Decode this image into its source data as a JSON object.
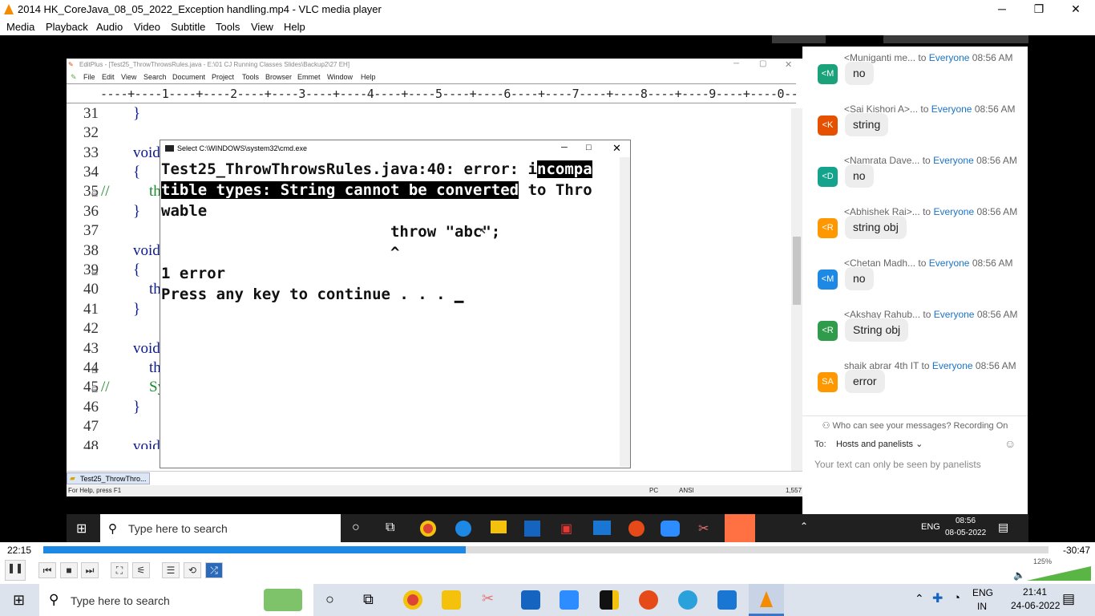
{
  "window": {
    "title": "2014 HK_CoreJava_08_05_2022_Exception handling.mp4 - VLC media player",
    "minimize": "─",
    "maximize": "❐",
    "close": "✕"
  },
  "menu": [
    "Media",
    "Playback",
    "Audio",
    "Video",
    "Subtitle",
    "Tools",
    "View",
    "Help"
  ],
  "editor": {
    "title": "EditPlus - [Test25_ThrowThrowsRules.java - E:\\01 CJ Running Classes Slides\\Backup2\\27 EH]",
    "menu": [
      "File",
      "Edit",
      "View",
      "Search",
      "Document",
      "Project",
      "Tools",
      "Browser",
      "Emmet",
      "Window",
      "Help"
    ],
    "ruler": "----+----1----+----2----+----3----+----4----+----5----+----6----+----7----+----8----+----9----+----0----+---",
    "lines": [
      {
        "num": "31",
        "code": "}"
      },
      {
        "num": "32",
        "code": ""
      },
      {
        "num": "33",
        "code": "void"
      },
      {
        "num": "34",
        "code": "{"
      },
      {
        "num": "35",
        "code": "th"
      },
      {
        "num": "36",
        "code": "}"
      },
      {
        "num": "37",
        "code": ""
      },
      {
        "num": "38",
        "code": "void"
      },
      {
        "num": "39",
        "code": "{"
      },
      {
        "num": "40",
        "code": "th"
      },
      {
        "num": "41",
        "code": "}"
      },
      {
        "num": "42",
        "code": ""
      },
      {
        "num": "43",
        "code": "void"
      },
      {
        "num": "44",
        "code": "th"
      },
      {
        "num": "45",
        "code": "Sy"
      },
      {
        "num": "46",
        "code": "}"
      },
      {
        "num": "47",
        "code": ""
      },
      {
        "num": "48",
        "code": "void"
      }
    ],
    "comment_marker": "//",
    "tab": "Test25_ThrowThro...",
    "status_left": "For Help, press F1",
    "status_pc": "PC",
    "status_ansi": "ANSI",
    "status_size": "1,557"
  },
  "cmd": {
    "title": "Select C:\\WINDOWS\\system32\\cmd.exe",
    "l1a": "Test25_ThrowThrowsRules.java:40: error: i",
    "l1b": "ncompa",
    "l2a": "tible types: String cannot be converted",
    "l2b": " to Thro",
    "l3": "wable",
    "l4": "                         throw \"abc\";",
    "l5": "                         ^",
    "l6": "1 error",
    "l7": "Press any key to continue . . . ",
    "cursor": "▁"
  },
  "chat": {
    "to": "to",
    "everyone": "Everyone",
    "messages": [
      {
        "sender": "<Muniganti me...",
        "time": "08:56 AM",
        "initials": "<M",
        "text": "no",
        "color": "#1aa37a"
      },
      {
        "sender": "<Sai Kishori A>...",
        "time": "08:56 AM",
        "initials": "<K",
        "text": "string",
        "color": "#e65100"
      },
      {
        "sender": "<Namrata Dave...",
        "time": "08:56 AM",
        "initials": "<D",
        "text": "no",
        "color": "#14a38c"
      },
      {
        "sender": "<Abhishek Rai>...",
        "time": "08:56 AM",
        "initials": "<R",
        "text": "string obj",
        "color": "#ff9800"
      },
      {
        "sender": "<Chetan Madh...",
        "time": "08:56 AM",
        "initials": "<M",
        "text": "no",
        "color": "#1e88e5"
      },
      {
        "sender": "<Akshay Rahub...",
        "time": "08:56 AM",
        "initials": "<R",
        "text": "String obj",
        "color": "#2e9c4a"
      },
      {
        "sender": "shaik abrar 4th IT",
        "time": "08:56 AM",
        "initials": "SA",
        "text": "error",
        "color": "#ff9800"
      }
    ],
    "who": "Who can see your messages? Recording On",
    "to_label": "To:",
    "recipient": "Hosts and panelists",
    "hint": "Your text can only be seen by panelists"
  },
  "inner_taskbar": {
    "search": "Type here to search",
    "lang": "ENG",
    "time": "08:56",
    "date": "08-05-2022"
  },
  "player": {
    "elapsed": "22:15",
    "remaining": "-30:47",
    "progress": 0.4199,
    "volume": "125%"
  },
  "taskbar": {
    "search": "Type here to search",
    "lang": "ENG",
    "region": "IN",
    "time": "21:41",
    "date": "24-06-2022"
  }
}
